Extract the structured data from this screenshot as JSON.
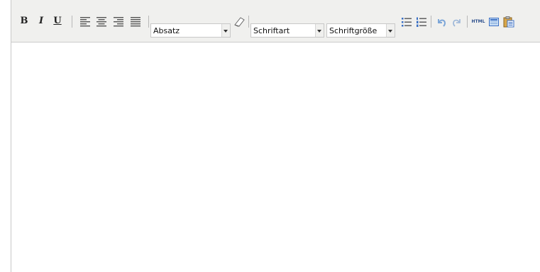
{
  "toolbar": {
    "bold_label": "B",
    "italic_label": "I",
    "underline_label": "U",
    "format_select": "Absatz",
    "font_select": "Schriftart",
    "size_select": "Schriftgröße",
    "html_label": "HTML"
  },
  "colors": {
    "toolbar_bg": "#f0f0ee",
    "icon_gray": "#555555",
    "bullet_blue": "#3a6fc4",
    "undo_blue": "#7ea7d8"
  },
  "icons": [
    "align-left-icon",
    "align-center-icon",
    "align-right-icon",
    "align-justify-icon",
    "eraser-icon",
    "bullet-list-icon",
    "numbered-list-icon",
    "undo-icon",
    "redo-icon",
    "html-icon",
    "insert-media-icon",
    "paste-word-icon"
  ],
  "content": {
    "body_text": ""
  }
}
